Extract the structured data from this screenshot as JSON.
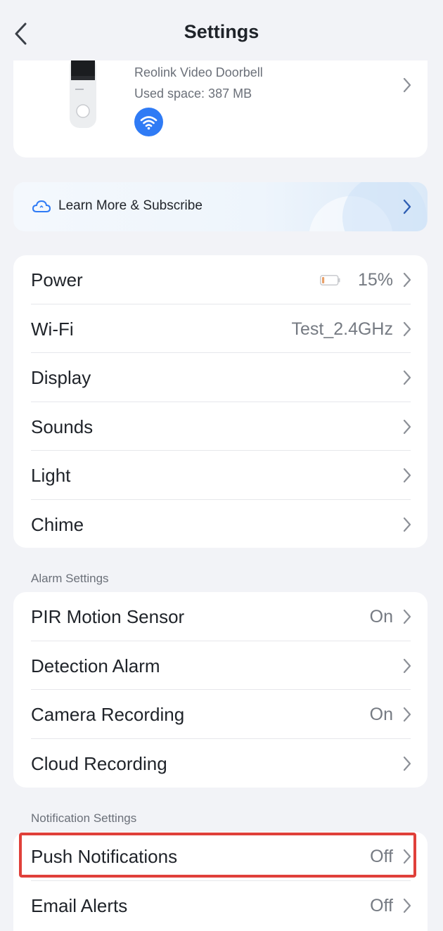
{
  "nav": {
    "title": "Settings"
  },
  "device": {
    "name": "Reolink Video Doorbell",
    "used_space": "Used space: 387 MB",
    "connection_icon": "wifi-icon"
  },
  "promo": {
    "label": "Learn More & Subscribe",
    "icon": "cloud-icon"
  },
  "general": {
    "rows": [
      {
        "label": "Power",
        "value": "15%",
        "battery_level": 0.15
      },
      {
        "label": "Wi-Fi",
        "value": "Test_2.4GHz"
      },
      {
        "label": "Display",
        "value": ""
      },
      {
        "label": "Sounds",
        "value": ""
      },
      {
        "label": "Light",
        "value": ""
      },
      {
        "label": "Chime",
        "value": ""
      }
    ]
  },
  "alarm": {
    "header": "Alarm Settings",
    "rows": [
      {
        "label": "PIR Motion Sensor",
        "value": "On"
      },
      {
        "label": "Detection Alarm",
        "value": ""
      },
      {
        "label": "Camera Recording",
        "value": "On"
      },
      {
        "label": "Cloud Recording",
        "value": ""
      }
    ]
  },
  "notification": {
    "header": "Notification Settings",
    "rows": [
      {
        "label": "Push Notifications",
        "value": "Off"
      },
      {
        "label": "Email Alerts",
        "value": "Off"
      }
    ]
  },
  "colors": {
    "background": "#f2f3f7",
    "accent_blue": "#2f7bf5",
    "highlight_red": "#e0403a",
    "battery_orange": "#e8a06a"
  }
}
